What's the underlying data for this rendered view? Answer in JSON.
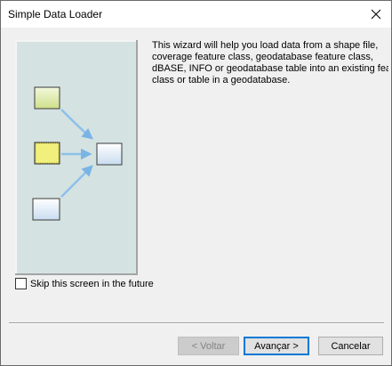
{
  "window": {
    "title": "Simple Data Loader"
  },
  "description": "This wizard will help you load data from a shape file,\ncoverage feature class, geodatabase feature class,\ndBASE, INFO or geodatabase table into an existing feature\nclass or table in a geodatabase.",
  "skip": {
    "label": "Skip this screen in the future",
    "checked": false
  },
  "buttons": {
    "back": "< Voltar",
    "next": "Avançar >",
    "cancel": "Cancelar"
  },
  "icons": {
    "close": "close-icon",
    "illustration": "data-loader-illustration"
  }
}
